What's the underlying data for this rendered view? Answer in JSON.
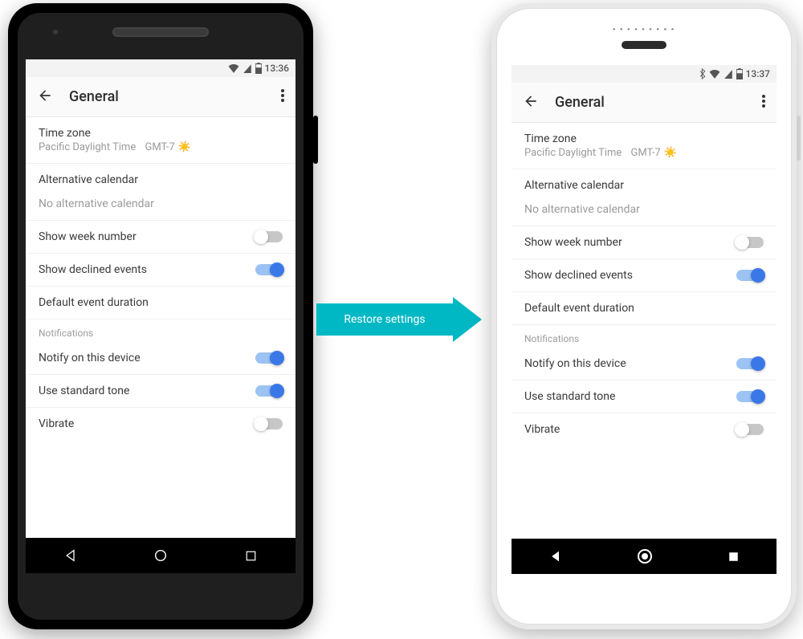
{
  "arrow_label": "Restore settings",
  "phone1": {
    "status": {
      "time": "13:36",
      "icons": [
        "wifi-icon",
        "signal-icon",
        "battery-icon"
      ]
    },
    "appbar": {
      "title": "General"
    },
    "timezone": {
      "label": "Time zone",
      "value_prefix": "Pacific Daylight Time",
      "value_suffix": "GMT-7"
    },
    "altcal": {
      "label": "Alternative calendar",
      "value": "No alternative calendar"
    },
    "week": {
      "label": "Show week number",
      "on": false
    },
    "declined": {
      "label": "Show declined events",
      "on": true
    },
    "duration": {
      "label": "Default event duration"
    },
    "section_notifications": "Notifications",
    "notify": {
      "label": "Notify on this device",
      "on": true
    },
    "tone": {
      "label": "Use standard tone",
      "on": true
    },
    "vibrate": {
      "label": "Vibrate",
      "on": false
    }
  },
  "phone2": {
    "status": {
      "time": "13:37",
      "icons": [
        "bluetooth-icon",
        "wifi-icon",
        "signal-icon",
        "battery-icon"
      ]
    },
    "appbar": {
      "title": "General"
    },
    "timezone": {
      "label": "Time zone",
      "value_prefix": "Pacific Daylight Time",
      "value_suffix": "GMT-7"
    },
    "altcal": {
      "label": "Alternative calendar",
      "value": "No alternative calendar"
    },
    "week": {
      "label": "Show week number",
      "on": false
    },
    "declined": {
      "label": "Show declined events",
      "on": true
    },
    "duration": {
      "label": "Default event duration"
    },
    "section_notifications": "Notifications",
    "notify": {
      "label": "Notify on this device",
      "on": true
    },
    "tone": {
      "label": "Use standard tone",
      "on": true
    },
    "vibrate": {
      "label": "Vibrate",
      "on": false
    }
  }
}
